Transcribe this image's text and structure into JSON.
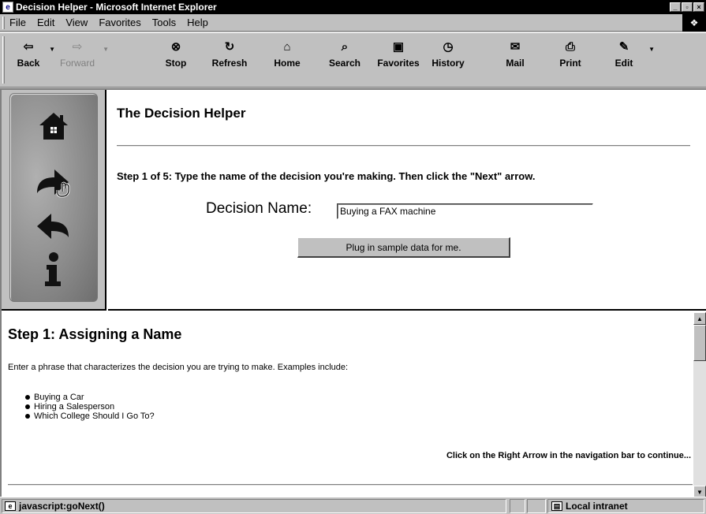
{
  "window": {
    "title": "Decision Helper - Microsoft Internet Explorer",
    "buttons": [
      "_",
      "▫",
      "×"
    ]
  },
  "menu": {
    "items": [
      "File",
      "Edit",
      "View",
      "Favorites",
      "Tools",
      "Help"
    ]
  },
  "toolbar": {
    "buttons": [
      {
        "label": "Back",
        "icon": "back-arrow-icon"
      },
      {
        "label": "Forward",
        "icon": "forward-arrow-icon"
      },
      {
        "label": "Stop",
        "icon": "stop-icon"
      },
      {
        "label": "Refresh",
        "icon": "refresh-icon"
      },
      {
        "label": "Home",
        "icon": "home-icon"
      },
      {
        "label": "Search",
        "icon": "search-icon"
      },
      {
        "label": "Favorites",
        "icon": "favorites-icon"
      },
      {
        "label": "History",
        "icon": "history-icon"
      },
      {
        "label": "Mail",
        "icon": "mail-icon"
      },
      {
        "label": "Print",
        "icon": "print-icon"
      },
      {
        "label": "Edit",
        "icon": "edit-icon"
      }
    ]
  },
  "nav": {
    "icons": [
      "home-icon",
      "next-arrow-icon",
      "back-arrow-icon",
      "info-icon"
    ]
  },
  "main": {
    "title": "The Decision Helper",
    "instruction": "Step 1 of 5: Type the name of the decision you're making. Then click the \"Next\" arrow.",
    "field_label": "Decision Name:",
    "field_value": "Buying a FAX machine",
    "sample_button": "Plug in sample data for me."
  },
  "help": {
    "title": "Step 1: Assigning a Name",
    "description": "Enter a phrase that characterizes the decision you are trying to make. Examples include:",
    "examples": [
      "Buying a Car",
      "Hiring a Salesperson",
      "Which College Should I Go To?"
    ],
    "continue_text": "Click on the Right Arrow in the navigation bar to continue..."
  },
  "status": {
    "text": "javascript:goNext()",
    "zone": "Local intranet"
  }
}
